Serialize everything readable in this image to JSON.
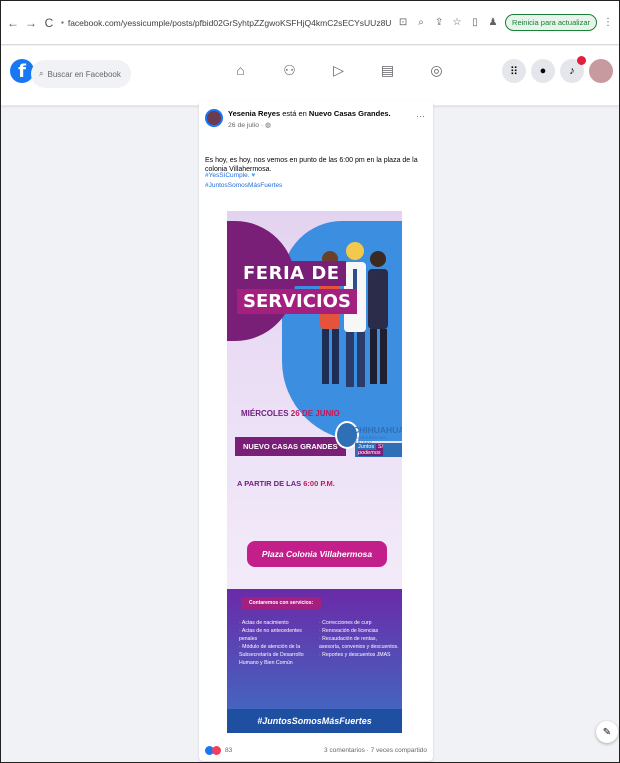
{
  "browser": {
    "url": "facebook.com/yessicumple/posts/pfbid02GrSyhtpZZgwoKSFHjQ4kmC2sECYsUUz8UFzepWMskH9mpuys1KC6fNPrZBzX3o6l",
    "reload_label": "Reinicia para actualizar"
  },
  "facebook": {
    "logo": "f",
    "search_placeholder": "Buscar en Facebook"
  },
  "post": {
    "author": "Yesenia Reyes",
    "action_text": "está en",
    "location": "Nuevo Casas Grandes.",
    "date": "26 de julio ·",
    "more": "···",
    "body": "Es hoy, es hoy, nos vemos en punto de las 6:00 pm en la plaza de la colonia Villahermosa.",
    "tag1": "#YesSíCumple.",
    "tag2": "#JuntosSomosMásFuertes",
    "reactions_count": "83",
    "stats": "3 comentarios · 7 veces compartido"
  },
  "flyer": {
    "title_line1": "FERIA DE",
    "title_line2": "SERVICIOS",
    "date_prefix": "MIÉRCOLES",
    "date_highlight": "26 DE JUNIO",
    "place": "NUEVO CASAS GRANDES",
    "time_prefix": "A PARTIR DE LAS",
    "time_highlight": "6:00 P.M.",
    "state_name": "CHIHUAHUA",
    "state_sub": "GOBIERNO DEL ESTADO",
    "slogan_a": "Juntos",
    "slogan_b": "Sí podemos",
    "plaza": "Plaza Colonia Villahermosa",
    "services_title": "Contaremos con servicios:",
    "services_left": [
      "Actas de nacimiento",
      "Actas de no antecedentes penales",
      "Módulo de atención de la Subsecretaría de Desarrollo Humano y Bien Común"
    ],
    "services_right": [
      "Correcciones de curp",
      "Renovación de licencias",
      "Recaudación de rentas, asesoría, convenios y descuentos.",
      "Reportes y descuentos JMAS"
    ],
    "hashtag": "#JuntosSomosMásFuertes"
  }
}
